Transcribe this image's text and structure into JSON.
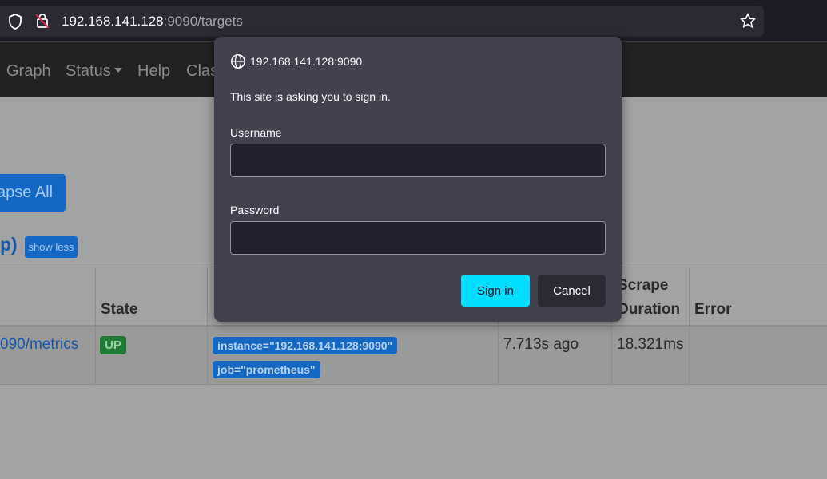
{
  "browser": {
    "url_host": "192.168.141.128",
    "url_rest": ":9090/targets",
    "icons": [
      "shield-icon",
      "lock-slash-icon",
      "star-icon"
    ]
  },
  "nav": {
    "items": [
      "Graph",
      "Status",
      "Help",
      "Clas"
    ]
  },
  "page": {
    "collapse_button": "apse All",
    "section_paren": "p)",
    "show_less": "show less",
    "headers": {
      "state": "State",
      "scrape_line1": "Scrape",
      "scrape_line2": "Duration",
      "error": "Error"
    },
    "row": {
      "endpoint": "090/metrics",
      "state": "UP",
      "labels": [
        "instance=\"192.168.141.128:9090\"",
        "job=\"prometheus\""
      ],
      "last_scrape": "7.713s ago",
      "scrape_duration": "18.321ms",
      "error": ""
    }
  },
  "dialog": {
    "host": "192.168.141.128:9090",
    "message": "This site is asking you to sign in.",
    "username_label": "Username",
    "username_value": "",
    "password_label": "Password",
    "password_value": "",
    "signin_label": "Sign in",
    "cancel_label": "Cancel"
  },
  "colors": {
    "accent": "#00ddff",
    "dialog_bg": "#42414d",
    "link": "#1567c4",
    "up_badge": "#1e7a34"
  }
}
